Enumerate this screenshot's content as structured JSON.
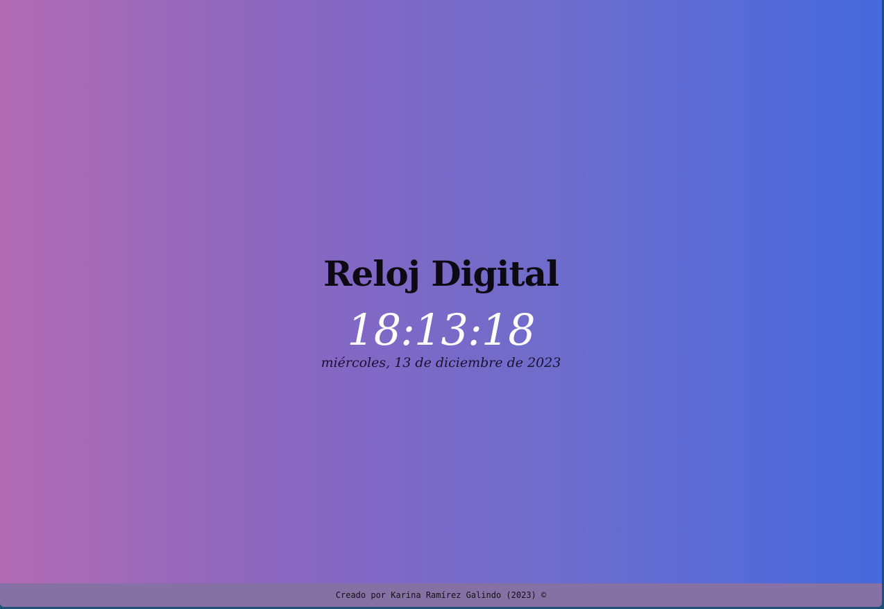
{
  "app": {
    "title": "Reloj Digital"
  },
  "clock": {
    "time": "18:13:18",
    "date": "miércoles, 13 de diciembre de 2023"
  },
  "footer": {
    "text": "Creado por Karina Ramírez Galindo (2023) ©"
  },
  "colors": {
    "gradient_start": "#b26bb3",
    "gradient_end": "#4669dc",
    "time_text": "#ffffff",
    "title_text": "#0d0a14",
    "footer_bg": "#8671a4"
  }
}
